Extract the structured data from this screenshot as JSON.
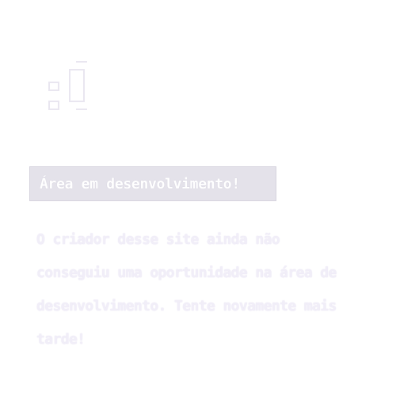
{
  "logo": {
    "icon": "pixel-logo-icon"
  },
  "notice": {
    "title": "Área em desenvolvimento!",
    "message": "O criador desse site ainda não conseguiu uma oportunidade na área de desenvolvimento. Tente novamente mais tarde!"
  },
  "colors": {
    "background": "#ffffff",
    "title_box": "#e4e2ea",
    "text": "#ffffff"
  }
}
